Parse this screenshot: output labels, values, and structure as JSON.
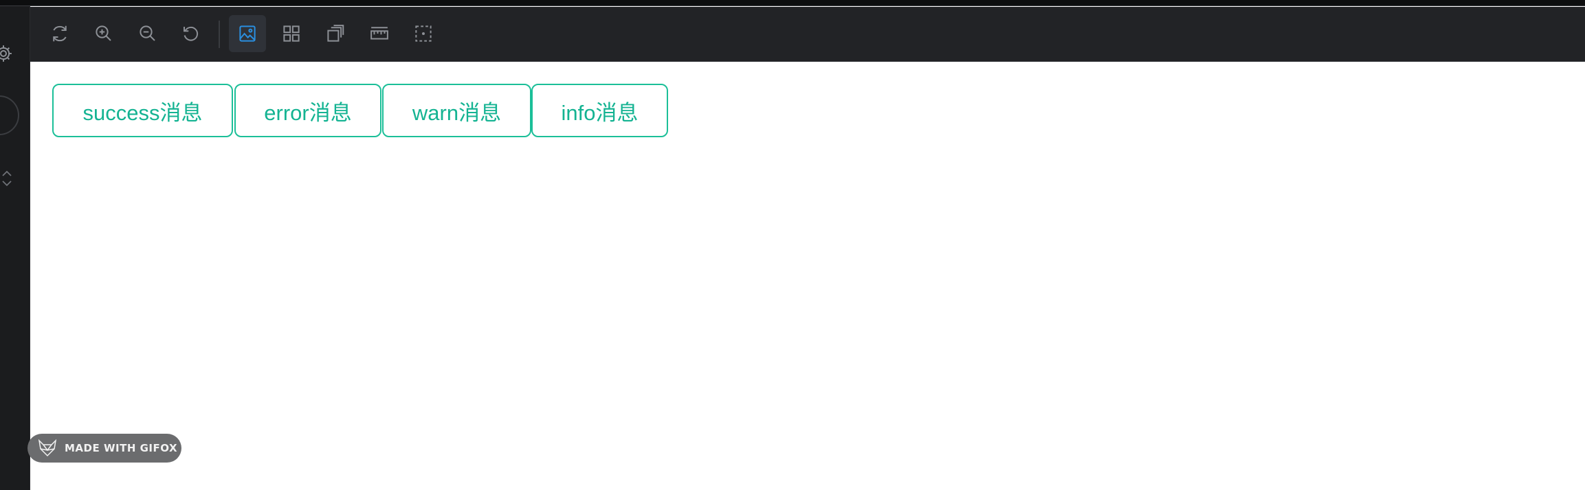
{
  "toolbar": {
    "icons": [
      "refresh-icon",
      "zoom-in-icon",
      "zoom-out-icon",
      "reset-icon",
      "image-icon",
      "grid-icon",
      "layers-icon",
      "ruler-icon",
      "select-area-icon"
    ],
    "active_icon": "image-icon",
    "active_color": "#2a8fe0",
    "icon_color": "#8d9096"
  },
  "buttons": [
    {
      "label": "success消息"
    },
    {
      "label": "error消息"
    },
    {
      "label": "warn消息"
    },
    {
      "label": "info消息"
    }
  ],
  "accent_color": "#1bbf98",
  "badge": {
    "text": "MADE WITH GIFOX"
  }
}
